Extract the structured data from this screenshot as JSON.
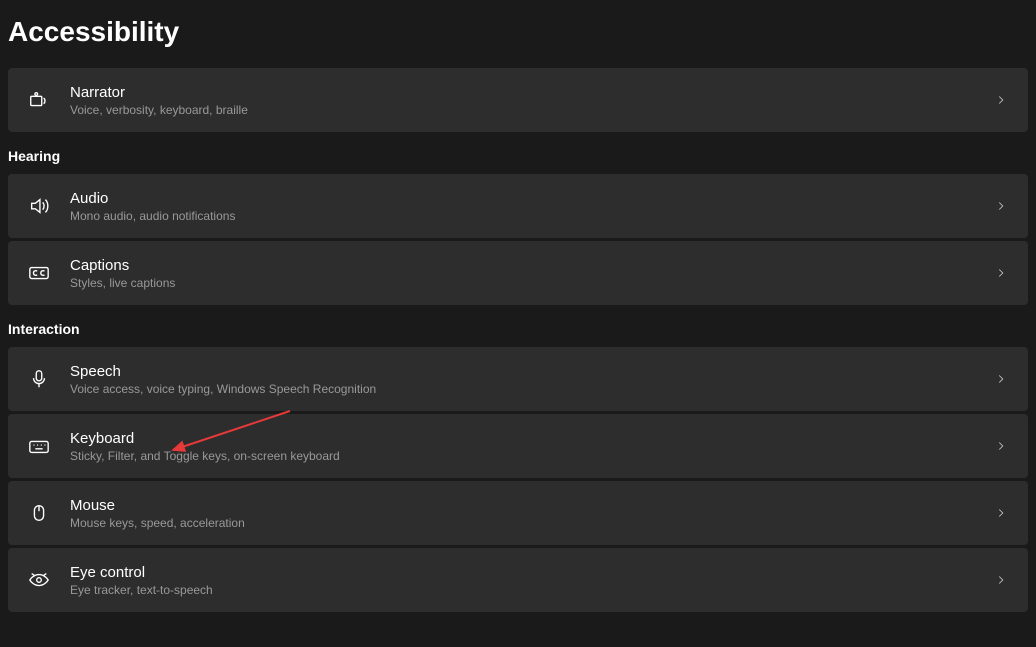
{
  "page": {
    "title": "Accessibility"
  },
  "groups": [
    {
      "header": null,
      "items": [
        {
          "icon": "narrator",
          "title": "Narrator",
          "desc": "Voice, verbosity, keyboard, braille"
        }
      ]
    },
    {
      "header": "Hearing",
      "items": [
        {
          "icon": "audio",
          "title": "Audio",
          "desc": "Mono audio, audio notifications"
        },
        {
          "icon": "captions",
          "title": "Captions",
          "desc": "Styles, live captions"
        }
      ]
    },
    {
      "header": "Interaction",
      "items": [
        {
          "icon": "speech",
          "title": "Speech",
          "desc": "Voice access, voice typing, Windows Speech Recognition"
        },
        {
          "icon": "keyboard",
          "title": "Keyboard",
          "desc": "Sticky, Filter, and Toggle keys, on-screen keyboard"
        },
        {
          "icon": "mouse",
          "title": "Mouse",
          "desc": "Mouse keys, speed, acceleration"
        },
        {
          "icon": "eyecontrol",
          "title": "Eye control",
          "desc": "Eye tracker, text-to-speech"
        }
      ]
    }
  ],
  "annotation": {
    "kind": "arrow",
    "target": "keyboard",
    "color": "#e63939"
  }
}
